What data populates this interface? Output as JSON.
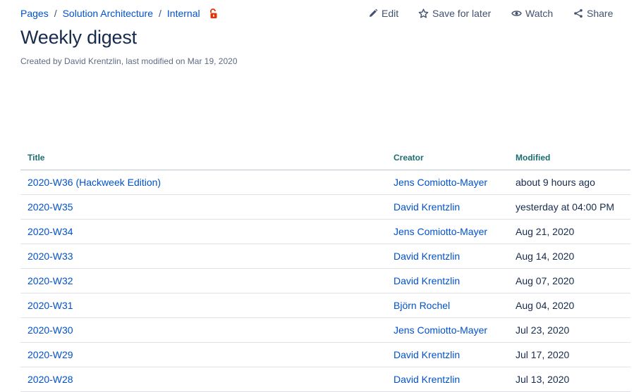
{
  "breadcrumb": {
    "items": [
      "Pages",
      "Solution Architecture",
      "Internal"
    ],
    "separator": "/",
    "restriction_icon": "unlocked-padlock-icon"
  },
  "actions": {
    "edit": "Edit",
    "save": "Save for later",
    "watch": "Watch",
    "share": "Share"
  },
  "page": {
    "title": "Weekly digest",
    "byline": "Created by David Krentzlin, last modified on Mar 19, 2020"
  },
  "table": {
    "headers": [
      "Title",
      "Creator",
      "Modified"
    ],
    "rows": [
      {
        "title": "2020-W36 (Hackweek Edition)",
        "creator": "Jens Comiotto-Mayer",
        "modified": "about 9 hours ago"
      },
      {
        "title": "2020-W35",
        "creator": "David Krentzlin",
        "modified": "yesterday at 04:00 PM"
      },
      {
        "title": "2020-W34",
        "creator": "Jens Comiotto-Mayer",
        "modified": "Aug 21, 2020"
      },
      {
        "title": "2020-W33",
        "creator": "David Krentzlin",
        "modified": "Aug 14, 2020"
      },
      {
        "title": "2020-W32",
        "creator": "David Krentzlin",
        "modified": "Aug 07, 2020"
      },
      {
        "title": "2020-W31",
        "creator": "Björn Rochel",
        "modified": "Aug 04, 2020"
      },
      {
        "title": "2020-W30",
        "creator": "Jens Comiotto-Mayer",
        "modified": "Jul 23, 2020"
      },
      {
        "title": "2020-W29",
        "creator": "David Krentzlin",
        "modified": "Jul 17, 2020"
      },
      {
        "title": "2020-W28",
        "creator": "David Krentzlin",
        "modified": "Jul 13, 2020"
      }
    ]
  },
  "colors": {
    "link": "#0052cc",
    "header_text": "#1c6d72",
    "lock": "#de350b",
    "title": "#172b4d"
  }
}
